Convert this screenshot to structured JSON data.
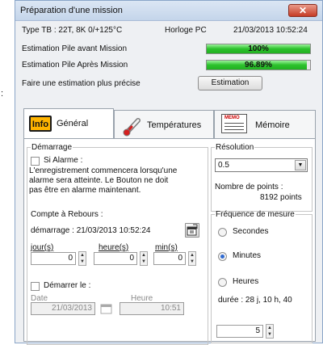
{
  "outside": {
    "colon": ":"
  },
  "window": {
    "title": "Préparation d'une mission",
    "close_glyph": "✕"
  },
  "info": {
    "type_tb": "Type TB :   22T, 8K 0/+125°C",
    "clock_label": "Horloge PC",
    "clock_value": "21/03/2013 10:52:24",
    "pile_before_label": "Estimation Pile avant Mission",
    "pile_before_value": "100%",
    "pile_before_fraction": 1.0,
    "pile_after_label": "Estimation Pile Après Mission",
    "pile_after_value": "96.89%",
    "pile_after_fraction": 0.9689,
    "precise_label": "Faire une estimation plus précise",
    "estimation_button": "Estimation"
  },
  "tabs": [
    {
      "icon_text": "Info",
      "label": "Général"
    },
    {
      "label": "Températures"
    },
    {
      "icon_text": "MEMO",
      "label": "Mémoire"
    }
  ],
  "demarrage": {
    "legend": "Démarrage",
    "alarm_label": "Si Alarme :",
    "alarm_text_1": "L'enregistrement commencera lorsqu'une",
    "alarm_text_2": "alarme sera atteinte. Le Bouton ne doit",
    "alarm_text_3": "pas être en alarme maintenant.",
    "countdown_label": "Compte à Rebours :",
    "start_text": "démarrage : 21/03/2013 10:52:24",
    "days_label": "jour(s)",
    "hours_label": "heure(s)",
    "mins_label": "min(s)",
    "days_value": "0",
    "hours_value": "0",
    "mins_value": "0",
    "start_at_label": "Démarrer le :",
    "date_label": "Date",
    "hour_label": "Heure",
    "date_value": "21/03/2013",
    "hour_value": "10:51"
  },
  "resolution": {
    "legend": "Résolution",
    "value": "0.5",
    "points_label": "Nombre de points :",
    "points_value": "8192 points"
  },
  "frequence": {
    "legend": "Fréquence de mesure",
    "options": [
      "Secondes",
      "Minutes",
      "Heures"
    ],
    "selected": "Minutes",
    "duration": "durée : 28 j,  10 h, 40",
    "interval_value": "5"
  },
  "colors": {
    "progress_green": "#2cc12c",
    "close_red": "#c53b25",
    "info_orange": "#f5a300"
  },
  "icons": {
    "clock": "clock-icon",
    "calendar": "calendar-icon",
    "thermometer": "thermometer-icon",
    "memo": "memo-icon",
    "info": "info-icon"
  }
}
